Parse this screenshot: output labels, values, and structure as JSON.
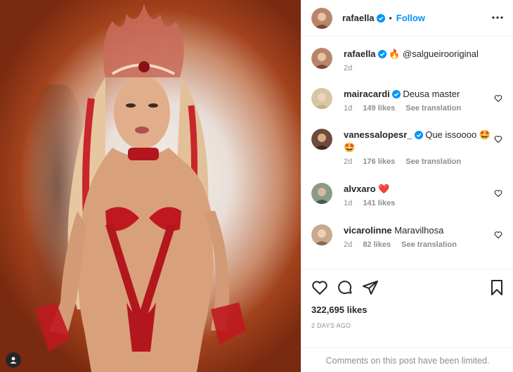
{
  "post": {
    "author": "rafaella",
    "follow_label": "Follow",
    "separator": "•"
  },
  "caption": {
    "user": "rafaella",
    "text": "🔥 @salgueirooriginal",
    "age": "2d"
  },
  "comments": [
    {
      "user": "mairacardi",
      "verified": true,
      "text": "Deusa master",
      "age": "1d",
      "likes": "149 likes",
      "translate": "See translation"
    },
    {
      "user": "vanessalopesr_",
      "verified": true,
      "text": "Que issoooo 🤩 🤩",
      "age": "2d",
      "likes": "176 likes",
      "translate": "See translation"
    },
    {
      "user": "alvxaro",
      "verified": false,
      "text": "❤️",
      "age": "1d",
      "likes": "141 likes",
      "translate": ""
    },
    {
      "user": "vicarolinne",
      "verified": false,
      "text": "Maravilhosa",
      "age": "2d",
      "likes": "82 likes",
      "translate": "See translation"
    }
  ],
  "engagement": {
    "likes": "322,695 likes",
    "timestamp": "2 DAYS AGO",
    "limited_notice": "Comments on this post have been limited."
  },
  "colors": {
    "accent": "#0095f6",
    "muted": "#8e8e8e",
    "text": "#262626",
    "border": "#efefef"
  },
  "icons": [
    "more-icon",
    "verified-badge-icon",
    "heart-icon",
    "comment-icon",
    "share-icon",
    "bookmark-icon",
    "user-icon"
  ]
}
